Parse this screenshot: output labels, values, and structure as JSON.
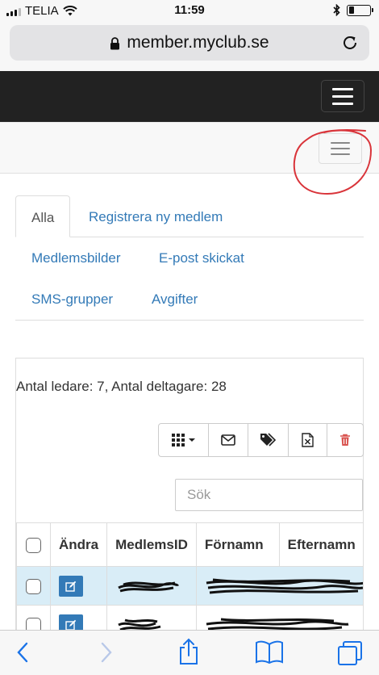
{
  "status_bar": {
    "carrier": "TELIA",
    "time": "11:59",
    "battery_level": 0.25
  },
  "browser": {
    "url": "member.myclub.se"
  },
  "tabs": [
    {
      "label": "Alla",
      "active": true
    },
    {
      "label": "Registrera ny medlem"
    },
    {
      "label": "Medlemsbilder"
    },
    {
      "label": "E-post skickat"
    },
    {
      "label": "SMS-grupper"
    },
    {
      "label": "Avgifter"
    }
  ],
  "summary": {
    "counts_text": "Antal ledare: 7, Antal deltagare: 28"
  },
  "toolbar": {
    "buttons": [
      "columns-icon",
      "envelope-icon",
      "tags-icon",
      "excel-icon",
      "trash-icon"
    ]
  },
  "search": {
    "placeholder": "Sök"
  },
  "table": {
    "headers": [
      "",
      "Ändra",
      "MedlemsID",
      "Förnamn",
      "Efternamn"
    ],
    "rows_visible": 2
  },
  "colors": {
    "link": "#337ab7",
    "navbar_dark": "#222222",
    "annotation": "#d9343a",
    "row_highlight": "#d9edf7",
    "delete": "#d9534f"
  }
}
